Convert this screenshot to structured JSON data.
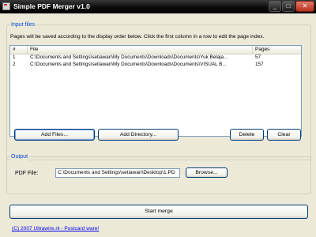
{
  "window": {
    "title": "Simple PDF Merger v1.0",
    "controls": {
      "minimize": "_",
      "maximize": "□",
      "close": "✕"
    }
  },
  "input_group": {
    "legend": "Input files",
    "info": "Pages will be saved according to the display order below. Click the first column in a row to edit the page index.",
    "columns": [
      "#",
      "File",
      "Pages"
    ],
    "rows": [
      {
        "index": "1",
        "file": "C:\\Documents and Settings\\setiawan\\My Documents\\Downloads\\Documents\\Yuk Belaja...",
        "pages": "57"
      },
      {
        "index": "2",
        "file": "C:\\Documents and Settings\\setiawan\\My Documents\\Downloads\\Documents\\VISUAL B...",
        "pages": "157"
      }
    ],
    "buttons": {
      "add_files": "Add Files...",
      "add_directory": "Add Directory...",
      "delete": "Delete",
      "clear": "Clear"
    }
  },
  "output_group": {
    "legend": "Output",
    "pdf_file_label": "PDF File:",
    "pdf_file_value": "C:\\Documents and Settings\\setiawan\\Desktop\\1.PD",
    "browse": "Browse..."
  },
  "start_merge": "Start merge",
  "footer_link": "(C) 2007 Ultrawire.nl - Postcard ware!"
}
